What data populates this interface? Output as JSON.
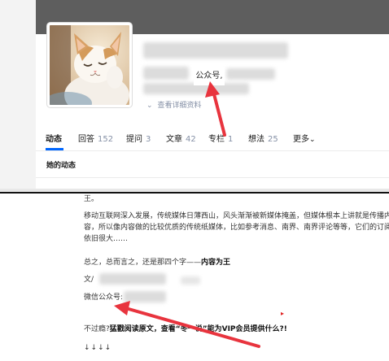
{
  "profile": {
    "callout_text": "公众号,",
    "details_link": "查看详细资料"
  },
  "tabs": [
    {
      "label": "动态",
      "count": ""
    },
    {
      "label": "回答",
      "count": "152"
    },
    {
      "label": "提问",
      "count": "3"
    },
    {
      "label": "文章",
      "count": "42"
    },
    {
      "label": "专栏",
      "count": "1"
    },
    {
      "label": "想法",
      "count": "25"
    },
    {
      "label": "更多",
      "count": ""
    }
  ],
  "section_title": "她的动态",
  "article": {
    "fragment": "王。",
    "para_main_lines": [
      "移动互联网深入发展，传统媒体日薄西山，风头渐渐被新媒体掩盖，但媒体根本上讲就是传播内",
      "容，所以像内容做的比较优质的传统纸媒体，比如参考消息、南界、南界评论等等，它们的订阅量",
      "依旧很大……"
    ],
    "summary_prefix": "总之，总而言之，还是那四个字——",
    "summary_bold": "内容为王",
    "author_prefix": "文/",
    "wechat_prefix": "微信公众号:",
    "readmore_prefix": "不过瘾?",
    "readmore_bold": "猛戳阅读原文，查看“冬一说”能为VIP会员提供什么?!",
    "arrows": "↓↓↓↓"
  },
  "colors": {
    "accent": "#0066ff",
    "arrow": "#e8343e",
    "cover": "#5e5e5e"
  },
  "icons": [
    "chevron-down-icon",
    "red-arrow-icon"
  ]
}
